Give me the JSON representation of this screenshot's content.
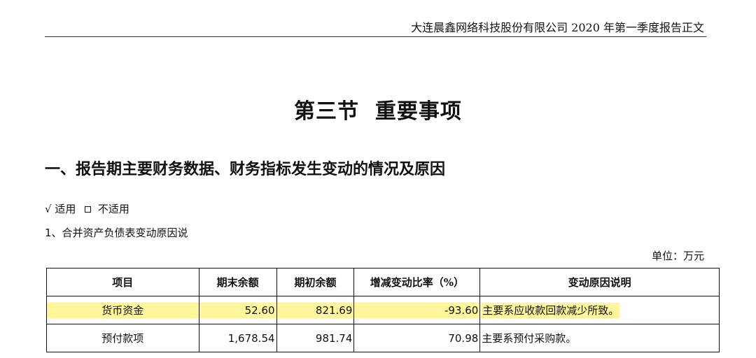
{
  "header": {
    "running_title": "大连晨鑫网络科技股份有限公司 2020 年第一季度报告正文"
  },
  "section": {
    "title": "第三节  重要事项"
  },
  "subsection": {
    "title": "一、报告期主要财务数据、财务指标发生变动的情况及原因"
  },
  "applicability": {
    "applicable_mark": "√",
    "applicable_label": "适用",
    "not_applicable_label": "不适用"
  },
  "item": {
    "label": "1、合并资产负债表变动原因说"
  },
  "unit": {
    "label": "单位：万元"
  },
  "table": {
    "headers": [
      "项目",
      "期末余额",
      "期初余额",
      "增减变动比率（%）",
      "变动原因说明"
    ],
    "rows": [
      {
        "item": "货币资金",
        "ending": "52.60",
        "opening": "821.69",
        "change": "-93.60",
        "reason": "主要系应收款回款减少所致。"
      },
      {
        "item": "预付款项",
        "ending": "1,678.54",
        "opening": "981.74",
        "change": "70.98",
        "reason": "主要系预付采购款。"
      }
    ]
  },
  "colors": {
    "highlight": "#fff59a"
  }
}
